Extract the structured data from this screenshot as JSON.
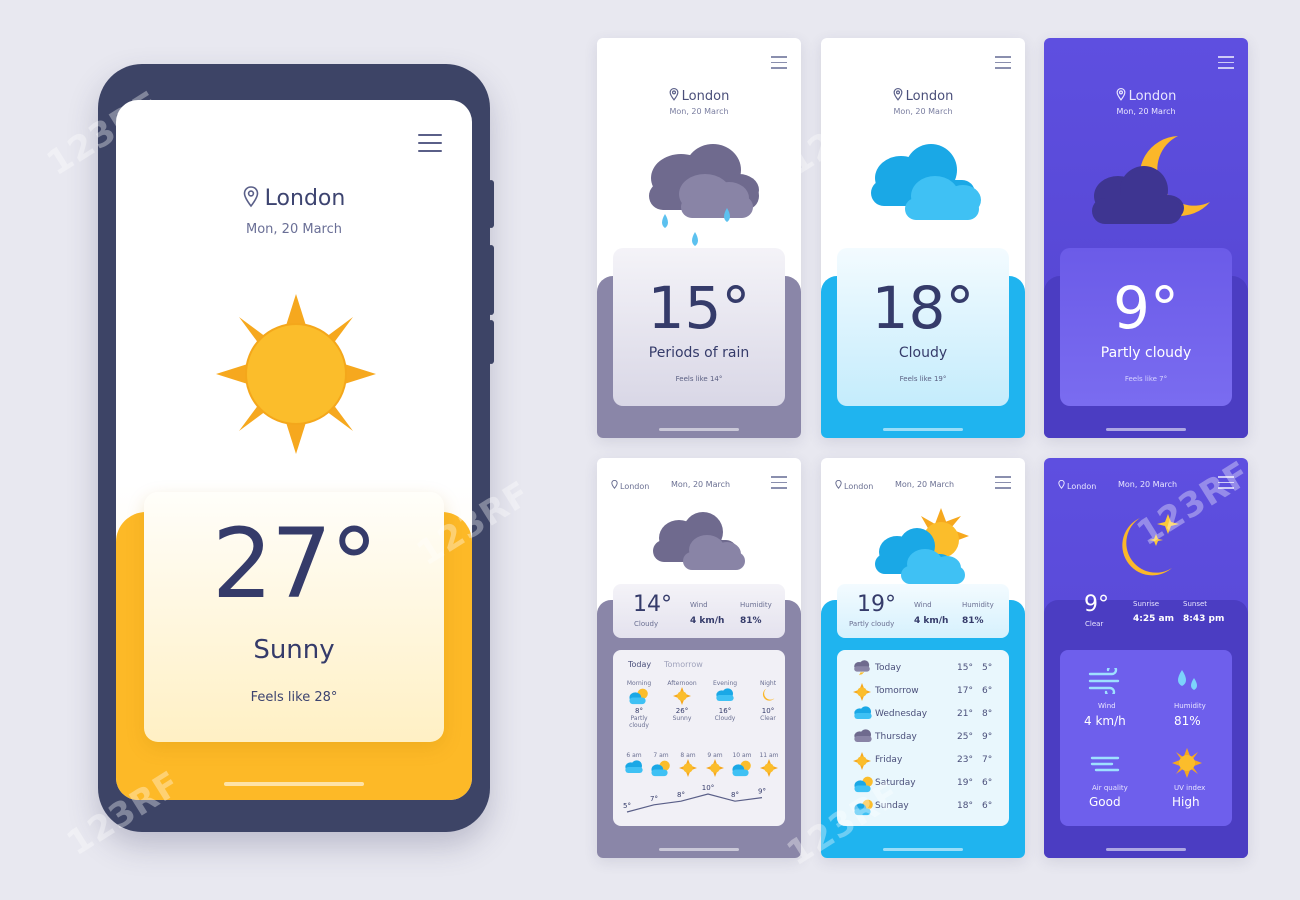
{
  "main": {
    "city": "London",
    "date": "Mon, 20 March",
    "temp": "27°",
    "condition": "Sunny",
    "feels_like": "Feels like 28°"
  },
  "screens_top": [
    {
      "city": "London",
      "date": "Mon, 20 March",
      "temp": "15°",
      "condition": "Periods of rain",
      "feels_like": "Feels like 14°"
    },
    {
      "city": "London",
      "date": "Mon, 20 March",
      "temp": "18°",
      "condition": "Cloudy",
      "feels_like": "Feels like 19°"
    },
    {
      "city": "London",
      "date": "Mon, 20 March",
      "temp": "9°",
      "condition": "Partly cloudy",
      "feels_like": "Feels like 7°"
    }
  ],
  "screen4": {
    "city": "London",
    "date": "Mon, 20 March",
    "temp": "14°",
    "condition": "Cloudy",
    "wind_label": "Wind",
    "wind_value": "4 km/h",
    "humidity_label": "Humidity",
    "humidity_value": "81%",
    "tab_today": "Today",
    "tab_tomorrow": "Tomorrow",
    "periods": [
      {
        "name": "Morning",
        "temp": "8°",
        "cond": "Partly cloudy",
        "icon": "partly-cloudy-icon"
      },
      {
        "name": "Afternoon",
        "temp": "26°",
        "cond": "Sunny",
        "icon": "sun-icon"
      },
      {
        "name": "Evening",
        "temp": "16°",
        "cond": "Cloudy",
        "icon": "cloud-icon"
      },
      {
        "name": "Night",
        "temp": "10°",
        "cond": "Clear",
        "icon": "moon-icon"
      }
    ],
    "hours": [
      {
        "time": "6 am",
        "temp": "5°"
      },
      {
        "time": "7 am",
        "temp": "7°"
      },
      {
        "time": "8 am",
        "temp": "8°"
      },
      {
        "time": "9 am",
        "temp": "10°"
      },
      {
        "time": "10 am",
        "temp": "8°"
      },
      {
        "time": "11 am",
        "temp": "9°"
      }
    ]
  },
  "screen5": {
    "city": "London",
    "date": "Mon, 20 March",
    "temp": "19°",
    "condition": "Partly cloudy",
    "wind_label": "Wind",
    "wind_value": "4 km/h",
    "humidity_label": "Humidity",
    "humidity_value": "81%",
    "days": [
      {
        "name": "Today",
        "hi": "15°",
        "lo": "5°"
      },
      {
        "name": "Tomorrow",
        "hi": "17°",
        "lo": "6°"
      },
      {
        "name": "Wednesday",
        "hi": "21°",
        "lo": "8°"
      },
      {
        "name": "Thursday",
        "hi": "25°",
        "lo": "9°"
      },
      {
        "name": "Friday",
        "hi": "23°",
        "lo": "7°"
      },
      {
        "name": "Saturday",
        "hi": "19°",
        "lo": "6°"
      },
      {
        "name": "Sunday",
        "hi": "18°",
        "lo": "6°"
      }
    ]
  },
  "screen6": {
    "city": "London",
    "date": "Mon, 20 March",
    "temp": "9°",
    "condition": "Clear",
    "sunrise_label": "Sunrise",
    "sunrise_value": "4:25 am",
    "sunset_label": "Sunset",
    "sunset_value": "8:43 pm",
    "wind_label": "Wind",
    "wind_value": "4 km/h",
    "humidity_label": "Humidity",
    "humidity_value": "81%",
    "air_label": "Air quality",
    "air_value": "Good",
    "uv_label": "UV index",
    "uv_value": "High"
  },
  "watermark": "123RF",
  "colors": {
    "sunny": "#fdb927",
    "rain": "#8a86a8",
    "cloudy": "#1fb4ef",
    "night": "#5b4bd9",
    "text": "#353b6a"
  }
}
